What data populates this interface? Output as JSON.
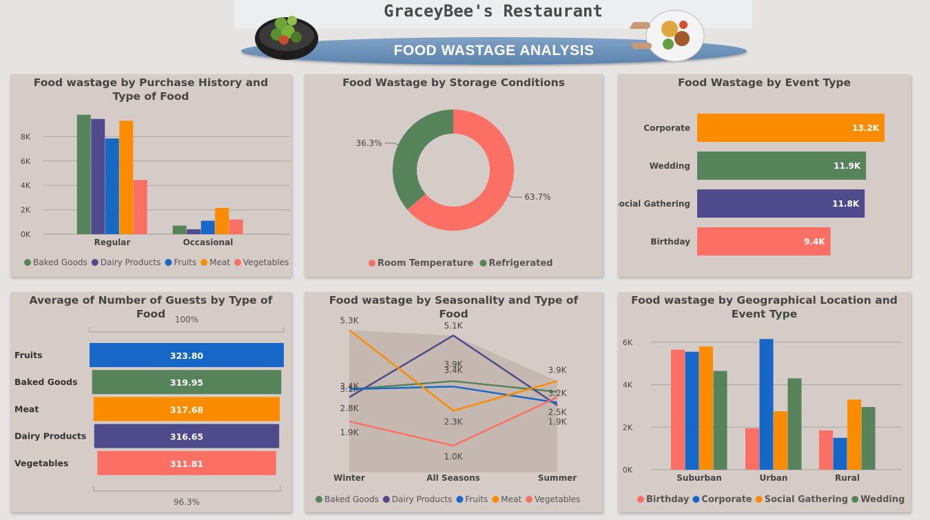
{
  "header": {
    "restaurant": "GraceyBee's Restaurant",
    "title": "FOOD WASTAGE ANALYSIS"
  },
  "colors": {
    "baked_goods": "#57835a",
    "dairy_products": "#4f4a8b",
    "fruits": "#1767c6",
    "meat": "#fb8c00",
    "vegetables": "#fc6f65",
    "panel_bg": "#d6ccc7"
  },
  "chart_data": [
    {
      "id": "purchase",
      "type": "bar",
      "title": "Food wastage by Purchase History and Type of Food",
      "categories": [
        "Regular",
        "Occasional"
      ],
      "yticks": [
        "0K",
        "2K",
        "4K",
        "6K",
        "8K"
      ],
      "ylim": [
        0,
        10000
      ],
      "series": [
        {
          "name": "Baked Goods",
          "values": [
            9800,
            700
          ]
        },
        {
          "name": "Dairy Products",
          "values": [
            9450,
            400
          ]
        },
        {
          "name": "Fruits",
          "values": [
            7850,
            1100
          ]
        },
        {
          "name": "Meat",
          "values": [
            9300,
            2150
          ]
        },
        {
          "name": "Vegetables",
          "values": [
            4450,
            1200
          ]
        }
      ],
      "legend_position": "bottom"
    },
    {
      "id": "storage",
      "type": "pie",
      "title": "Food Wastage by Storage Conditions",
      "slices": [
        {
          "name": "Room Temperature",
          "value": 63.7,
          "label": "63.7%"
        },
        {
          "name": "Refrigerated",
          "value": 36.3,
          "label": "36.3%"
        }
      ],
      "legend_position": "bottom"
    },
    {
      "id": "event",
      "type": "bar",
      "orientation": "horizontal",
      "title": "Food Wastage by Event Type",
      "categories": [
        "Corporate",
        "Wedding",
        "Social Gathering",
        "Birthday"
      ],
      "values": [
        13200,
        11900,
        11800,
        9400
      ],
      "labels": [
        "13.2K",
        "11.9K",
        "11.8K",
        "9.4K"
      ]
    },
    {
      "id": "guests",
      "type": "bar",
      "orientation": "horizontal",
      "title": "Average of Number of Guests by Type of Food",
      "categories": [
        "Fruits",
        "Baked Goods",
        "Meat",
        "Dairy Products",
        "Vegetables"
      ],
      "values": [
        323.8,
        319.95,
        317.68,
        316.65,
        311.81
      ],
      "labels": [
        "323.80",
        "319.95",
        "317.68",
        "316.65",
        "311.81"
      ],
      "top_label": "100%",
      "bottom_label": "96.3%"
    },
    {
      "id": "season",
      "type": "line",
      "title": "Food wastage by Seasonality and Type of Food",
      "categories": [
        "Winter",
        "All Seasons",
        "Summer"
      ],
      "ylim": [
        0,
        6000
      ],
      "series": [
        {
          "name": "Baked Goods",
          "values": [
            3100,
            3400,
            3000
          ],
          "labels": [
            "3.1K",
            "3.4K",
            ""
          ]
        },
        {
          "name": "Dairy Products",
          "values": [
            2800,
            5100,
            2500
          ],
          "labels": [
            "2.8K",
            "5.1K",
            "2.5K"
          ]
        },
        {
          "name": "Fruits",
          "values": [
            3100,
            3200,
            2600
          ],
          "labels": [
            "3.4K",
            "3.9K",
            "1.9K"
          ]
        },
        {
          "name": "Meat",
          "values": [
            5300,
            2300,
            3400
          ],
          "labels": [
            "5.3K",
            "2.3K",
            "3.9K"
          ]
        },
        {
          "name": "Vegetables",
          "values": [
            1900,
            1000,
            2800
          ],
          "labels": [
            "1.9K",
            "1.0K",
            "3.2K"
          ]
        }
      ],
      "legend_position": "bottom"
    },
    {
      "id": "geo",
      "type": "bar",
      "title": "Food wastage by Geographical Location and Event Type",
      "categories": [
        "Suburban",
        "Urban",
        "Rural"
      ],
      "yticks": [
        "0K",
        "2K",
        "4K",
        "6K"
      ],
      "ylim": [
        0,
        7000
      ],
      "series": [
        {
          "name": "Birthday",
          "values": [
            5650,
            1950,
            1850
          ]
        },
        {
          "name": "Corporate",
          "values": [
            5550,
            6150,
            1500
          ]
        },
        {
          "name": "Social Gathering",
          "values": [
            5800,
            2750,
            3300
          ]
        },
        {
          "name": "Wedding",
          "values": [
            4650,
            4300,
            2950
          ]
        }
      ],
      "legend_position": "bottom"
    }
  ]
}
